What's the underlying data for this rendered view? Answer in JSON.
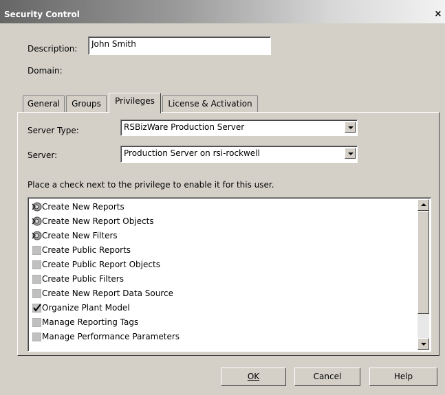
{
  "window": {
    "title": "Security Control",
    "close_glyph": "×"
  },
  "form": {
    "description_label": "Description:",
    "description_value": "John Smith",
    "domain_label": "Domain:"
  },
  "tabs": [
    {
      "label": "General",
      "active": false
    },
    {
      "label": "Groups",
      "active": false
    },
    {
      "label": "Privileges",
      "active": true
    },
    {
      "label": "License & Activation",
      "active": false
    }
  ],
  "privileges": {
    "server_type_label": "Server Type:",
    "server_type_value": "RSBizWare Production Server",
    "server_label": "Server:",
    "server_value": "Production Server on rsi-rockwell",
    "instruction": "Place a check next to the privilege to enable it for this user.",
    "items": [
      {
        "label": "Create New Reports",
        "state": "inherited-icon"
      },
      {
        "label": "Create New Report Objects",
        "state": "inherited-icon"
      },
      {
        "label": "Create New Filters",
        "state": "inherited-icon"
      },
      {
        "label": "Create Public Reports",
        "state": "unchecked"
      },
      {
        "label": "Create Public Report Objects",
        "state": "unchecked"
      },
      {
        "label": "Create Public Filters",
        "state": "unchecked"
      },
      {
        "label": "Create New Report Data Source",
        "state": "unchecked"
      },
      {
        "label": "Organize Plant Model",
        "state": "checked"
      },
      {
        "label": "Manage Reporting Tags",
        "state": "unchecked"
      },
      {
        "label": "Manage Performance Parameters",
        "state": "unchecked"
      }
    ]
  },
  "buttons": {
    "ok_label": "OK",
    "cancel_label": "Cancel",
    "help_label": "Help"
  }
}
